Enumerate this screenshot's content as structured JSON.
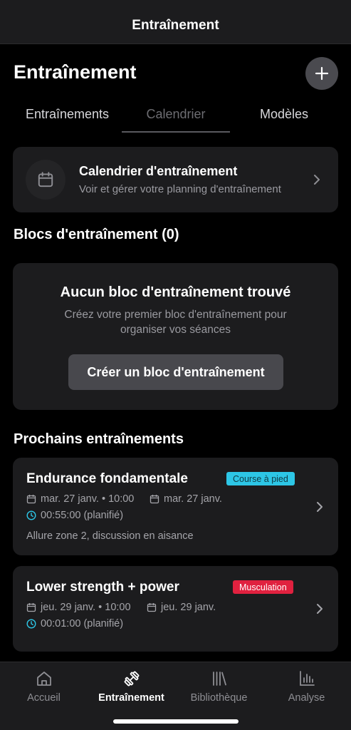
{
  "topbar": {
    "title": "Entraînement"
  },
  "header": {
    "title": "Entraînement",
    "add_icon": "plus-icon"
  },
  "tabs": [
    {
      "label": "Entraînements"
    },
    {
      "label": "Calendrier",
      "selected": true
    },
    {
      "label": "Modèles"
    }
  ],
  "calendar_card": {
    "title": "Calendrier d'entraînement",
    "subtitle": "Voir et gérer votre planning d'entraînement",
    "icon": "calendar-icon"
  },
  "blocks": {
    "section_title": "Blocs d'entraînement (0)",
    "empty_title": "Aucun bloc d'entraînement trouvé",
    "empty_desc": "Créez votre premier bloc d'entraînement pour organiser vos séances",
    "create_label": "Créer un bloc d'entraînement"
  },
  "upcoming": {
    "section_title": "Prochains entraînements",
    "items": [
      {
        "title": "Endurance fondamentale",
        "badge": "Course à pied",
        "badge_color": "#2dc6e6",
        "start": "mar. 27 janv. • 10:00",
        "end": "mar. 27 janv.",
        "duration": "00:55:00 (planifié)",
        "description": "Allure zone 2, discussion en aisance"
      },
      {
        "title": "Lower strength + power",
        "badge": "Musculation",
        "badge_color": "#e0213f",
        "start": "jeu. 29 janv. • 10:00",
        "end": "jeu. 29 janv.",
        "duration": "00:01:00 (planifié)"
      }
    ]
  },
  "bottom_nav": [
    {
      "label": "Accueil",
      "icon": "home-icon"
    },
    {
      "label": "Entraînement",
      "icon": "dumbbell-icon",
      "active": true
    },
    {
      "label": "Bibliothèque",
      "icon": "library-icon"
    },
    {
      "label": "Analyse",
      "icon": "bar-chart-icon"
    }
  ],
  "colors": {
    "background": "#000000",
    "card": "#1c1c1e",
    "accent_cyan": "#2dc6e6",
    "accent_red": "#e0213f"
  }
}
